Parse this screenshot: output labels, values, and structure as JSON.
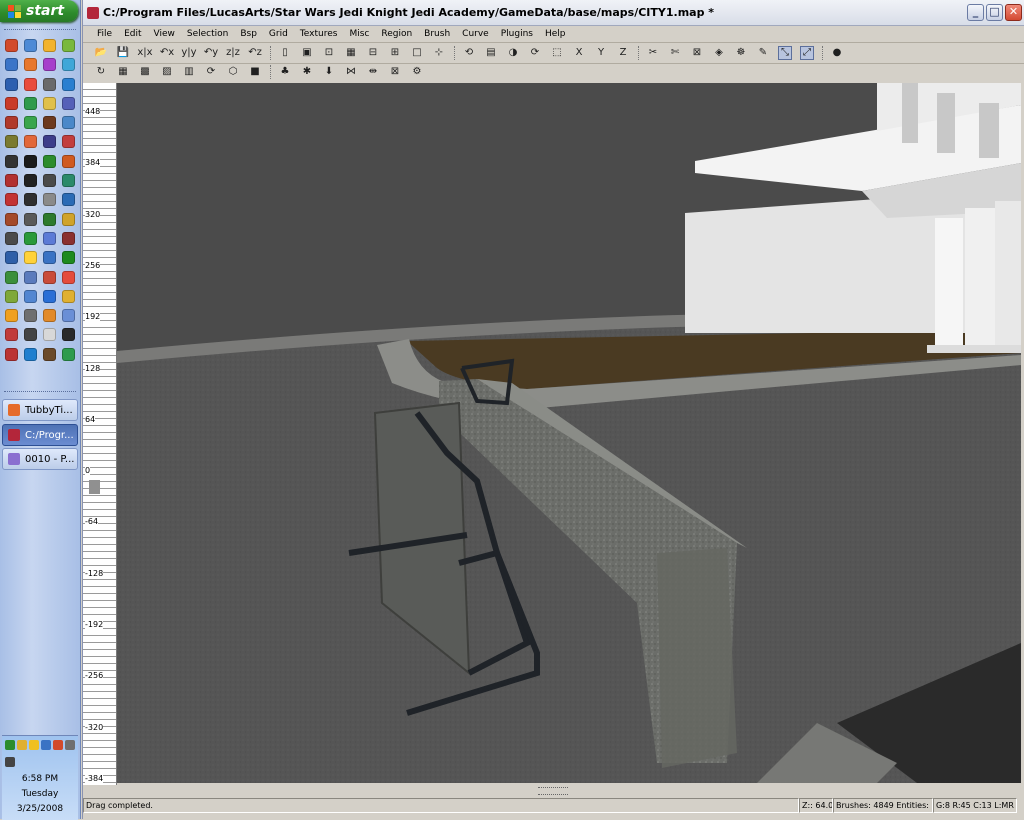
{
  "taskbar": {
    "start_label": "start",
    "quick_launch_count": 68,
    "quick_launch_colors": [
      "#d24a2b",
      "#4d8ad6",
      "#f2b32e",
      "#79b83c",
      "#3a74c8",
      "#e8772d",
      "#a63ecb",
      "#3fa7d8",
      "#2c5fb0",
      "#e94b3c",
      "#6a6a6a",
      "#2a7fd0",
      "#c93a28",
      "#2f9b4c",
      "#e0c04a",
      "#5560b8",
      "#b0392b",
      "#3aa54c",
      "#6d3a1f",
      "#4a88c9",
      "#7a7a30",
      "#e2673a",
      "#3d3d8a",
      "#c23d3d",
      "#333333",
      "#1b1b1b",
      "#2c8c2c",
      "#d05a20",
      "#b23030",
      "#222222",
      "#4a4a4a",
      "#2b8a6a",
      "#c33333",
      "#303030",
      "#8a8a8a",
      "#2b6bb5",
      "#a44a2a",
      "#5a5a5a",
      "#2d7a2d",
      "#d0a32a",
      "#4b4b4b",
      "#2a9a3a",
      "#5c7bd6",
      "#8a3030",
      "#2e5fa8",
      "#ffd23a",
      "#3a73c4",
      "#1e8a1e",
      "#3b8f3b",
      "#5a7bbd",
      "#c94c3a",
      "#e44b3c",
      "#7fa83a",
      "#5286d1",
      "#2a6fd6",
      "#e0b030",
      "#f0a020",
      "#6f6f6f",
      "#e28a2a",
      "#6a8fd6",
      "#c13a3a",
      "#444444",
      "#d8d8d8",
      "#2a2a2a",
      "#bb3333",
      "#1f7fcf",
      "#6b4a2a",
      "#2d9b4d"
    ],
    "tasks": [
      {
        "label": "TubbyTi...",
        "icon": "firefox-icon",
        "color": "#e56b2a",
        "active": false
      },
      {
        "label": "C:/Progr...",
        "icon": "jedi-academy-icon",
        "color": "#b3263a",
        "active": true
      },
      {
        "label": "0010 - P...",
        "icon": "image-file-icon",
        "color": "#8a6fd0",
        "active": false
      }
    ],
    "tray_icon_colors": [
      "#2c8c2c",
      "#e0b030",
      "#f0c020",
      "#3a73c4",
      "#d24a2b",
      "#6f6f6f",
      "#444444"
    ],
    "time": "6:58 PM",
    "day": "Tuesday",
    "date": "3/25/2008"
  },
  "window": {
    "title": "C:/Program Files/LucasArts/Star Wars Jedi Knight Jedi Academy/GameData/base/maps/CITY1.map *",
    "controls": {
      "minimize": "_",
      "maximize": "□",
      "close": "✕"
    }
  },
  "menu": [
    "File",
    "Edit",
    "View",
    "Selection",
    "Bsp",
    "Grid",
    "Textures",
    "Misc",
    "Region",
    "Brush",
    "Curve",
    "Plugins",
    "Help"
  ],
  "toolbar1": [
    {
      "name": "open-icon",
      "glyph": "📂"
    },
    {
      "name": "save-icon",
      "glyph": "💾"
    },
    {
      "name": "flip-x-icon",
      "glyph": "x|x"
    },
    {
      "name": "rotate-x-icon",
      "glyph": "↶x"
    },
    {
      "name": "flip-y-icon",
      "glyph": "y|y"
    },
    {
      "name": "rotate-y-icon",
      "glyph": "↶y"
    },
    {
      "name": "flip-z-icon",
      "glyph": "z|z"
    },
    {
      "name": "rotate-z-icon",
      "glyph": "↶z"
    },
    {
      "name": "select-complete-tall-icon",
      "glyph": "▯"
    },
    {
      "name": "select-touching-icon",
      "glyph": "▣"
    },
    {
      "name": "select-partial-tall-icon",
      "glyph": "⊡"
    },
    {
      "name": "select-inside-icon",
      "glyph": "▦"
    },
    {
      "name": "csg-subtract-icon",
      "glyph": "⊟"
    },
    {
      "name": "csg-merge-icon",
      "glyph": "⊞"
    },
    {
      "name": "hollow-icon",
      "glyph": "□"
    },
    {
      "name": "clipper-icon",
      "glyph": "⊹"
    },
    {
      "name": "change-views-icon",
      "glyph": "⟲"
    },
    {
      "name": "texture-view-icon",
      "glyph": "▤"
    },
    {
      "name": "camera-icon",
      "glyph": "◑"
    },
    {
      "name": "texture-lock-icon",
      "glyph": "⟳"
    },
    {
      "name": "scale-icon",
      "glyph": "⬚"
    },
    {
      "name": "axis-x-icon",
      "glyph": "X"
    },
    {
      "name": "axis-y-icon",
      "glyph": "Y"
    },
    {
      "name": "axis-z-icon",
      "glyph": "Z"
    },
    {
      "name": "cubic-clip-icon",
      "glyph": "✂"
    },
    {
      "name": "filter-icon",
      "glyph": "✄"
    },
    {
      "name": "show-entities-icon",
      "glyph": "⊠"
    },
    {
      "name": "patch-icon",
      "glyph": "◈"
    },
    {
      "name": "bend-icon",
      "glyph": "☸"
    },
    {
      "name": "paint-icon",
      "glyph": "✎"
    },
    {
      "name": "select-tool-icon",
      "glyph": "⤡",
      "active": true
    },
    {
      "name": "drag-tool-icon",
      "glyph": "⤢",
      "active": true
    },
    {
      "name": "plugin-red-icon",
      "glyph": "●"
    }
  ],
  "toolbar2": [
    {
      "name": "camera-refresh-icon",
      "glyph": "↻"
    },
    {
      "name": "grid-icon",
      "glyph": "▦"
    },
    {
      "name": "wireframe-icon",
      "glyph": "▩"
    },
    {
      "name": "shaded-icon",
      "glyph": "▨"
    },
    {
      "name": "lightmap-icon",
      "glyph": "▥"
    },
    {
      "name": "cycle-icon",
      "glyph": "⟳"
    },
    {
      "name": "hexagon-icon",
      "glyph": "⬡"
    },
    {
      "name": "magenta-square-icon",
      "glyph": "■"
    },
    {
      "name": "tree-icon",
      "glyph": "♣"
    },
    {
      "name": "bug-icon",
      "glyph": "✱"
    },
    {
      "name": "arrow-down-icon",
      "glyph": "⬇"
    },
    {
      "name": "mirror-red-icon",
      "glyph": "⋈"
    },
    {
      "name": "mirror-double-icon",
      "glyph": "⇹"
    },
    {
      "name": "entity-box-icon",
      "glyph": "⊠"
    },
    {
      "name": "misc-icon",
      "glyph": "⚙"
    }
  ],
  "ruler": {
    "labels": [
      "448",
      "384",
      "320",
      "256",
      "192",
      "128",
      "64",
      "0",
      "-64",
      "-128",
      "-192",
      "-256",
      "-320",
      "-384"
    ]
  },
  "status": {
    "message": "Drag completed.",
    "zoom": "Z:: 64.0",
    "counts": "Brushes: 4849 Entities: 0",
    "grid_info": "G:8 R:45 C:13 L:MR"
  },
  "colors": {
    "sky": "#4b4b4b",
    "ground": "#545454",
    "dirt": "#4a3a22",
    "building": "#e4e4e4",
    "stone": "#6f716c",
    "bench": "#1f2328"
  }
}
